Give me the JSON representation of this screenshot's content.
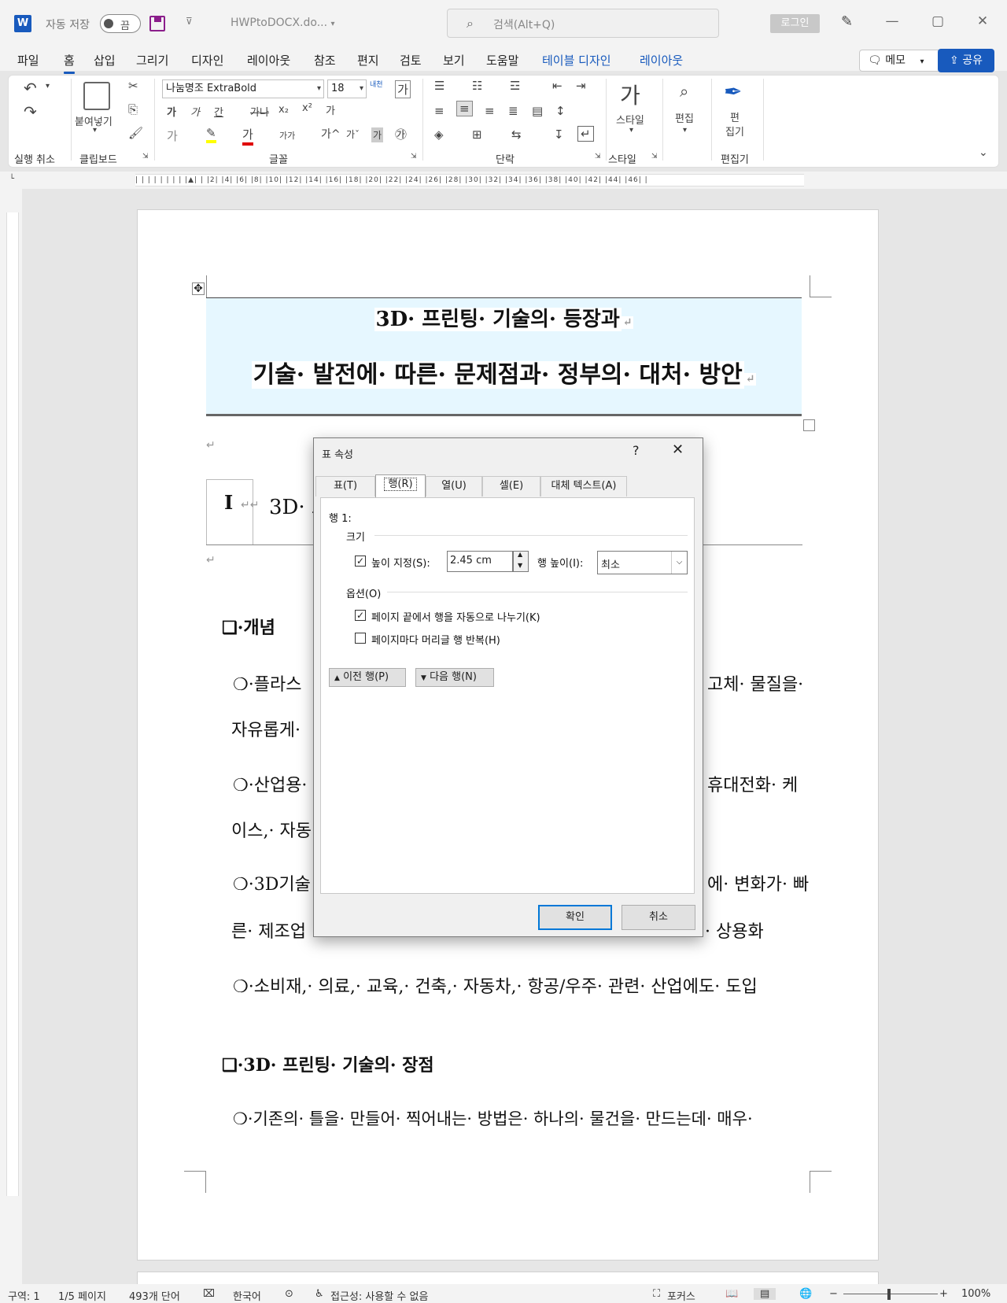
{
  "titlebar": {
    "app_icon": "W",
    "autosave_label": "자동 저장",
    "autosave_state": "끔",
    "filename": "HWPtoDOCX.do...",
    "search_placeholder": "검색(Alt+Q)",
    "login_label": "로그인"
  },
  "tabs": [
    "파일",
    "홈",
    "삽입",
    "그리기",
    "디자인",
    "레이아웃",
    "참조",
    "편지",
    "검토",
    "보기",
    "도움말",
    "테이블 디자인",
    "레이아웃"
  ],
  "active_tab": "홈",
  "memo_label": "메모",
  "share_label": "공유",
  "ribbon": {
    "undo_group": "실행 취소",
    "clipboard_group": "클립보드",
    "paste_label": "붙여넣기",
    "font_group": "글꼴",
    "font_name": "나눔명조 ExtraBold",
    "font_size": "18",
    "paragraph_group": "단락",
    "styles_group": "스타일",
    "styles_label": "스타일",
    "editing_label": "편집",
    "editor_group": "편집기",
    "editor_label": "편\n집기"
  },
  "ruler_text": "| | | | | | | | |▲| | |2| |4| |6| |8| |10| |12| |14| |16| |18| |20| |22| |24| |26| |28| |30| |32| |34| |36| |38| |40| |42| |44| |46| |",
  "document": {
    "title_line1": "3D· 프린팅· 기술의· 등장과",
    "title_line2": "기술· 발전에· 따른· 문제점과· 정부의· 대처· 방안",
    "section1_marker": "I",
    "section1_heading": "3D· 프",
    "concept_heading": "❑·개념",
    "p1a": "❍·플라스",
    "p1b": "고체· 물질을·",
    "p1c": "자유롭게·",
    "p2a": "❍·산업용·",
    "p2b": "휴대전화· 케",
    "p2c": "이스,· 자동",
    "p3a": "❍·3D기술",
    "p3b": "에· 변화가· 빠",
    "p3c": "른· 제조업",
    "p3d": "· 상용화",
    "p4": "❍·소비재,· 의료,· 교육,· 건축,· 자동차,· 항공/우주· 관련· 산업에도· 도입",
    "advantages_heading": "❑·3D· 프린팅· 기술의· 장점",
    "p5": "❍·기존의· 틀을· 만들어· 찍어내는· 방법은· 하나의· 물건을· 만드는데· 매우·"
  },
  "dialog": {
    "title": "표 속성",
    "help": "?",
    "close": "✕",
    "tabs": [
      "표(T)",
      "행(R)",
      "열(U)",
      "셀(E)",
      "대체 텍스트(A)"
    ],
    "active_tab": "행(R)",
    "row_label": "행 1:",
    "size_section": "크기",
    "specify_height_label": "높이 지정(S):",
    "specify_height_checked": true,
    "height_value": "2.45 cm",
    "row_height_label": "행 높이(I):",
    "row_height_mode": "최소",
    "options_section": "옵션(O)",
    "option1_label": "페이지 끝에서 행을 자동으로 나누기(K)",
    "option1_checked": true,
    "option2_label": "페이지마다 머리글 행 반복(H)",
    "option2_checked": false,
    "prev_row": "이전 행(P)",
    "next_row": "다음 행(N)",
    "ok": "확인",
    "cancel": "취소"
  },
  "statusbar": {
    "section": "구역: 1",
    "page": "1/5 페이지",
    "words": "493개 단어",
    "language": "한국어",
    "accessibility": "접근성: 사용할 수 없음",
    "focus": "포커스",
    "zoom": "100%"
  }
}
